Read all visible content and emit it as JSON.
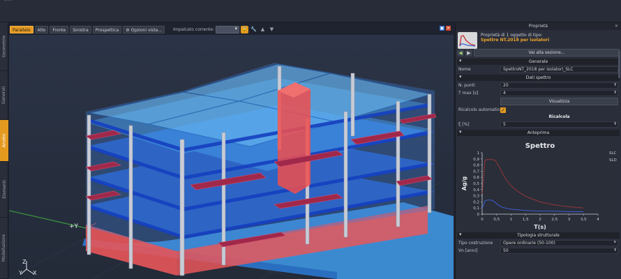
{
  "left_tabs": [
    "Geometrie",
    "Generali",
    "Analisi",
    "Elementi",
    "Modellazione"
  ],
  "active_left_tab": "Analisi",
  "view_toolbar": {
    "buttons": [
      "Parallelo",
      "Alto",
      "Fronte",
      "Sinistra",
      "Prospettica"
    ],
    "active": "Parallelo",
    "options_label": "Opzioni vista...",
    "floor_label": "Impalcato corrente:",
    "floor_value": ""
  },
  "axes": {
    "y_label": "+Y",
    "z_label": "Z",
    "y2_label": "Y",
    "x_label": "X"
  },
  "panel": {
    "title": "Proprietà",
    "object_line1": "Proprietà di 1 oggetto di tipo:",
    "object_line2": "Spettro NT.2018 per isolatori",
    "goto_section": "Vai alla sezione...",
    "sections": {
      "general": "Generale",
      "spectrum_data": "Dati spettro",
      "preview": "Anteprima",
      "structural_type": "Tipologia strutturale"
    },
    "fields": {
      "name_label": "Nome",
      "name_value": "SpettroNT_2018 per isolatori_SLC",
      "npoints_label": "N. punti",
      "npoints_value": "20",
      "tmax_label": "T max [s]",
      "tmax_value": "4",
      "visualize_button": "Visualizza",
      "autocalc_label": "Ricalcolo automatico",
      "recalc_label": "Ricalcola",
      "xi_label": "ξ [%]",
      "xi_value": "5",
      "construction_label": "Tipo costruzione",
      "construction_value": "Opere ordinarie (50-100)",
      "vn_label": "Vn [anni]",
      "vn_value": "50"
    }
  },
  "chart_data": {
    "type": "line",
    "title": "Spettro",
    "xlabel": "T(s)",
    "ylabel": "Ag/g",
    "xlim": [
      0,
      4
    ],
    "ylim": [
      0,
      1
    ],
    "x_ticks": [
      "0",
      "0,5",
      "1",
      "1,5",
      "2",
      "2,5",
      "3",
      "3,5",
      "4"
    ],
    "y_ticks": [
      "0",
      "0,1",
      "0,2",
      "0,3",
      "0,4",
      "0,5",
      "0,6",
      "0,7",
      "0,8",
      "0,9",
      "1"
    ],
    "series": [
      {
        "name": "SLC",
        "color": "#c83a3a",
        "x": [
          0,
          0.1,
          0.2,
          0.3,
          0.45,
          0.6,
          0.8,
          1.0,
          1.2,
          1.5,
          2.0,
          2.5,
          3.0,
          3.5
        ],
        "y": [
          0.34,
          0.88,
          0.89,
          0.89,
          0.88,
          0.76,
          0.58,
          0.46,
          0.38,
          0.29,
          0.2,
          0.15,
          0.12,
          0.1
        ]
      },
      {
        "name": "SLD",
        "color": "#3a5fd6",
        "x": [
          0,
          0.1,
          0.2,
          0.3,
          0.4,
          0.55,
          0.7,
          1.0,
          1.5,
          2.0,
          2.5,
          3.0,
          3.5
        ],
        "y": [
          0.09,
          0.22,
          0.23,
          0.23,
          0.21,
          0.15,
          0.11,
          0.08,
          0.06,
          0.05,
          0.05,
          0.04,
          0.04
        ]
      }
    ],
    "legend_position": "top-right",
    "grid": false
  }
}
